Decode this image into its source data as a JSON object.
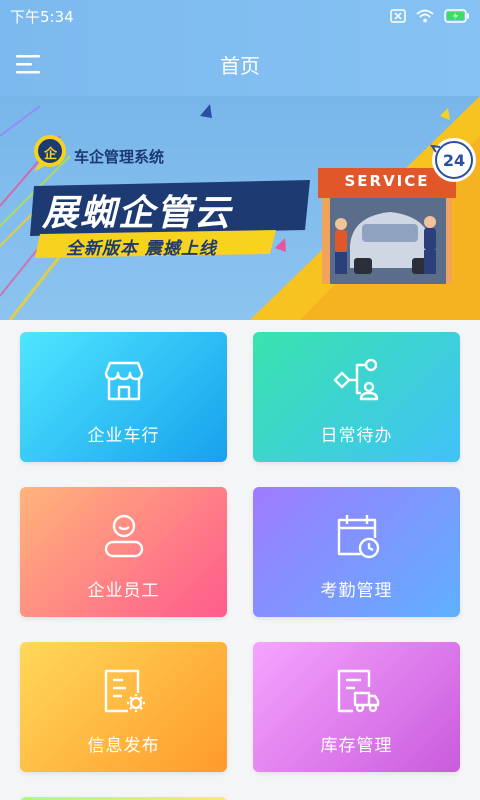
{
  "status_bar": {
    "time": "下午5:34"
  },
  "header": {
    "title": "首页",
    "menu_icon": "hamburger-menu-icon"
  },
  "banner": {
    "brand_badge": "企",
    "system_name": "车企管理系统",
    "product_name": "展蜘企管云",
    "tagline": "全新版本 震撼上线",
    "service_sign": "SERVICE",
    "hours_badge": "24",
    "colors": {
      "yellow": "#f7d21e",
      "orange": "#f5a623",
      "navy": "#1d3a72"
    }
  },
  "tiles": [
    {
      "label": "企业车行",
      "icon": "storefront-icon"
    },
    {
      "label": "日常待办",
      "icon": "flow-tasks-icon"
    },
    {
      "label": "企业员工",
      "icon": "person-icon"
    },
    {
      "label": "考勤管理",
      "icon": "calendar-clock-icon"
    },
    {
      "label": "信息发布",
      "icon": "document-gear-icon"
    },
    {
      "label": "库存管理",
      "icon": "document-truck-icon"
    }
  ]
}
